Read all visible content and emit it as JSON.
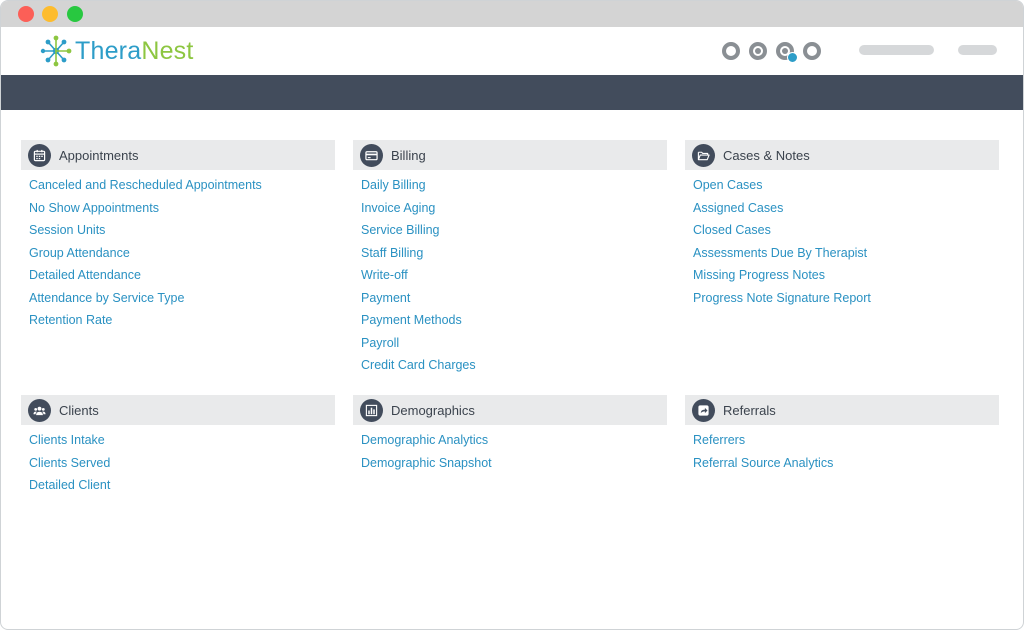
{
  "app": {
    "logo_part1": "Thera",
    "logo_part2": "Nest",
    "colors": {
      "brand_blue": "#2d9dc8",
      "brand_green": "#8dc641",
      "navband": "#424c5c",
      "link": "#2a91c2"
    }
  },
  "header_icons": [
    "settings-circle-icon",
    "help-circle-icon",
    "notifications-circle-icon",
    "user-circle-icon"
  ],
  "sections": {
    "appointments": {
      "title": "Appointments",
      "icon": "calendar-icon",
      "links": [
        "Canceled and Rescheduled Appointments",
        "No Show Appointments",
        "Session Units",
        "Group Attendance",
        "Detailed Attendance",
        "Attendance by Service Type",
        "Retention Rate"
      ]
    },
    "billing": {
      "title": "Billing",
      "icon": "credit-card-icon",
      "links": [
        "Daily Billing",
        "Invoice Aging",
        "Service Billing",
        "Staff Billing",
        "Write-off",
        "Payment",
        "Payment Methods",
        "Payroll",
        "Credit Card Charges"
      ]
    },
    "cases": {
      "title": "Cases & Notes",
      "icon": "folder-open-icon",
      "links": [
        "Open Cases",
        "Assigned Cases",
        "Closed Cases",
        "Assessments Due By Therapist",
        "Missing Progress Notes",
        "Progress Note Signature Report"
      ]
    },
    "clients": {
      "title": "Clients",
      "icon": "users-icon",
      "links": [
        "Clients Intake",
        "Clients Served",
        "Detailed Client"
      ]
    },
    "demographics": {
      "title": "Demographics",
      "icon": "bar-chart-icon",
      "links": [
        "Demographic Analytics",
        "Demographic Snapshot"
      ]
    },
    "referrals": {
      "title": "Referrals",
      "icon": "share-icon",
      "links": [
        "Referrers",
        "Referral Source Analytics"
      ]
    }
  }
}
